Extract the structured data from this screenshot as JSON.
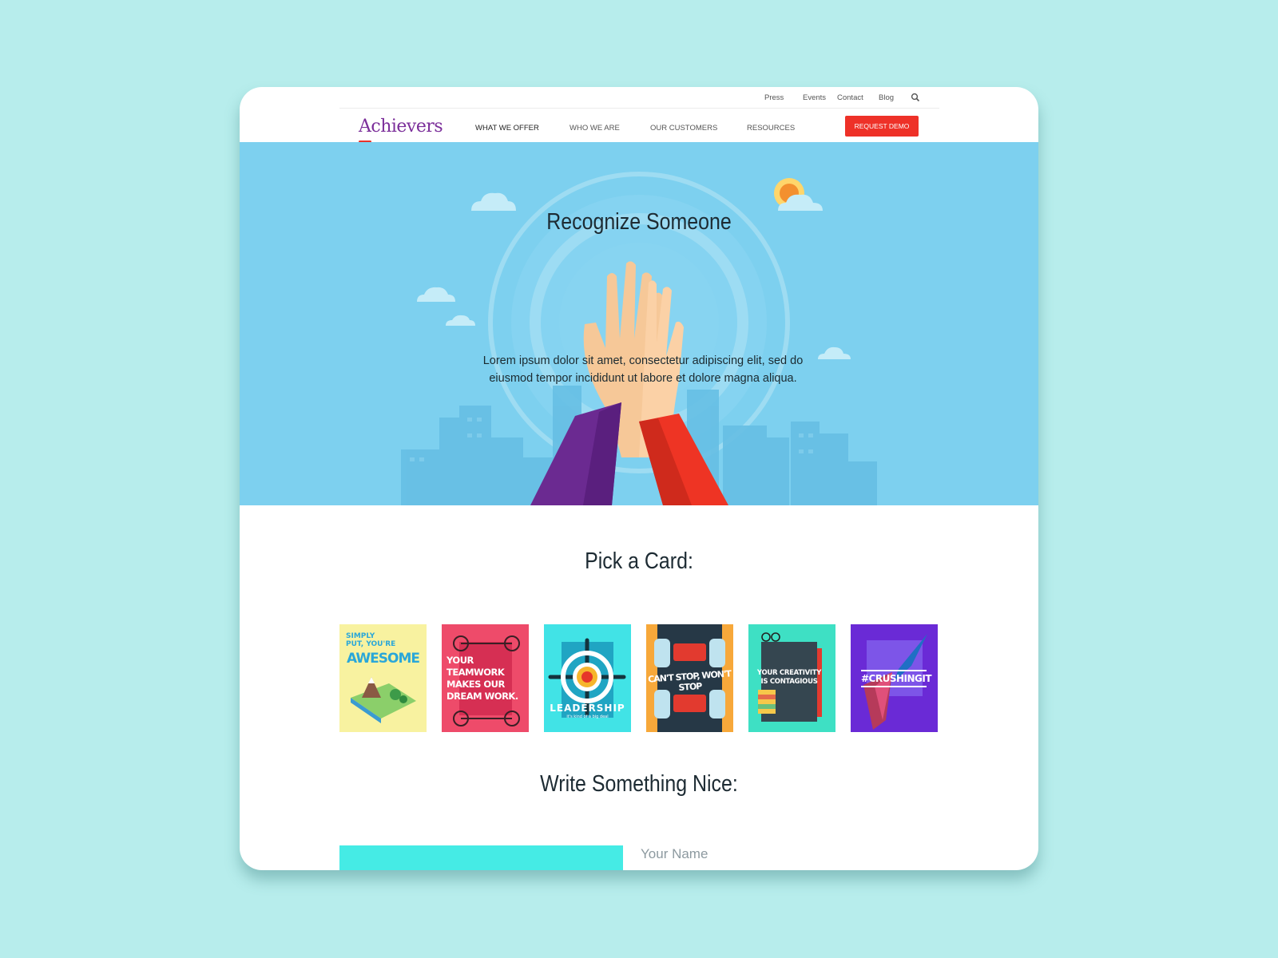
{
  "utility_nav": {
    "links": [
      "Press",
      "Events",
      "Contact",
      "Blog"
    ],
    "search_icon": "search-icon"
  },
  "main_nav": {
    "logo_text": "Achievers",
    "items": [
      "WHAT WE OFFER",
      "WHO WE ARE",
      "OUR CUSTOMERS",
      "RESOURCES"
    ],
    "cta_label": "REQUEST DEMO"
  },
  "hero": {
    "title": "Recognize Someone",
    "body": "Lorem ipsum dolor sit amet, consectetur adipiscing elit, sed do eiusmod tempor incididunt ut labore et dolore magna aliqua."
  },
  "cards_section": {
    "title": "Pick a Card:",
    "cards": [
      {
        "text": "SIMPLY PUT, YOU'RE AWESOME",
        "line1": "SIMPLY",
        "line2": "PUT, YOU'RE",
        "line3": "AWESOME"
      },
      {
        "text": "YOUR TEAMWORK MAKES OUR DREAM WORK.",
        "line1": "YOUR",
        "line2": "TEAMWORK",
        "line3": "MAKES OUR",
        "line4": "DREAM WORK."
      },
      {
        "text": "LEADERSHIP",
        "line1": "LEADERSHIP",
        "line2": "it's kind of a big deal"
      },
      {
        "text": "CAN'T STOP, WON'T STOP",
        "line1": "CAN'T STOP, WON'T STOP"
      },
      {
        "text": "YOUR CREATIVITY IS CONTAGIOUS",
        "line1": "YOUR CREATIVITY",
        "line2": "IS CONTAGIOUS"
      },
      {
        "text": "#CRUSHINGIT",
        "line1": "#CRUSHINGIT"
      }
    ]
  },
  "form_section": {
    "title": "Write Something Nice:",
    "name_placeholder": "Your Name"
  },
  "colors": {
    "page_bg": "#b7edec",
    "hero_bg": "#7dd0ef",
    "cta": "#ee3128",
    "logo": "#7b2e9a",
    "text_block": "#45ebe5"
  }
}
